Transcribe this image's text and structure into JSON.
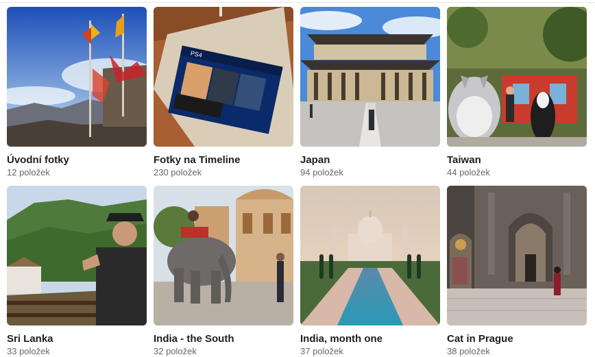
{
  "albums": [
    {
      "title": "Úvodní fotky",
      "count": "12 položek"
    },
    {
      "title": "Fotky na Timeline",
      "count": "230 položek"
    },
    {
      "title": "Japan",
      "count": "94 položek"
    },
    {
      "title": "Taiwan",
      "count": "44 položek"
    },
    {
      "title": "Sri Lanka",
      "count": "33 položek"
    },
    {
      "title": "India - the South",
      "count": "32 položek"
    },
    {
      "title": "India, month one",
      "count": "37 položek"
    },
    {
      "title": "Cat in Prague",
      "count": "38 položek"
    }
  ],
  "photos": {
    "box_label": "PS4"
  }
}
